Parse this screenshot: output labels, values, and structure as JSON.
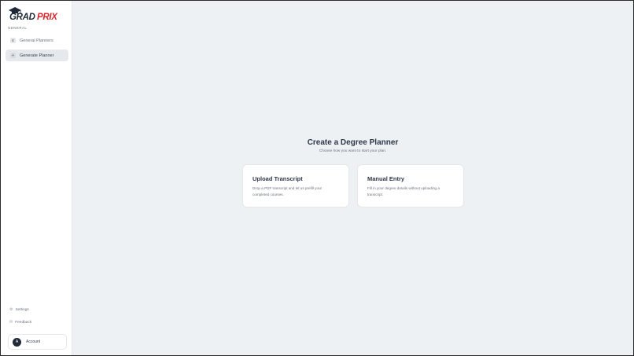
{
  "sidebar": {
    "logo_text": "GRADPRIX",
    "section_label": "GENERAL",
    "items": [
      {
        "label": "General Planners",
        "icon": "list-icon",
        "active": false
      },
      {
        "label": "Generate Planner",
        "icon": "plus-icon",
        "active": true
      }
    ],
    "footer": {
      "settings_label": "Settings",
      "feedback_label": "Feedback",
      "account_label": "Account",
      "avatar_initial": "A"
    }
  },
  "main": {
    "title": "Create a Degree Planner",
    "subtitle": "Choose how you want to start your plan.",
    "cards": [
      {
        "title": "Upload Transcript",
        "description": "Drop a PDF transcript and let us prefill your completed courses."
      },
      {
        "title": "Manual Entry",
        "description": "Fill in your degree details without uploading a transcript."
      }
    ]
  },
  "colors": {
    "accent_red": "#d9262c",
    "sidebar_bg": "#ffffff",
    "main_bg": "#edf1f3",
    "active_item_bg": "#e5e9ed",
    "avatar_bg": "#1f2937"
  }
}
